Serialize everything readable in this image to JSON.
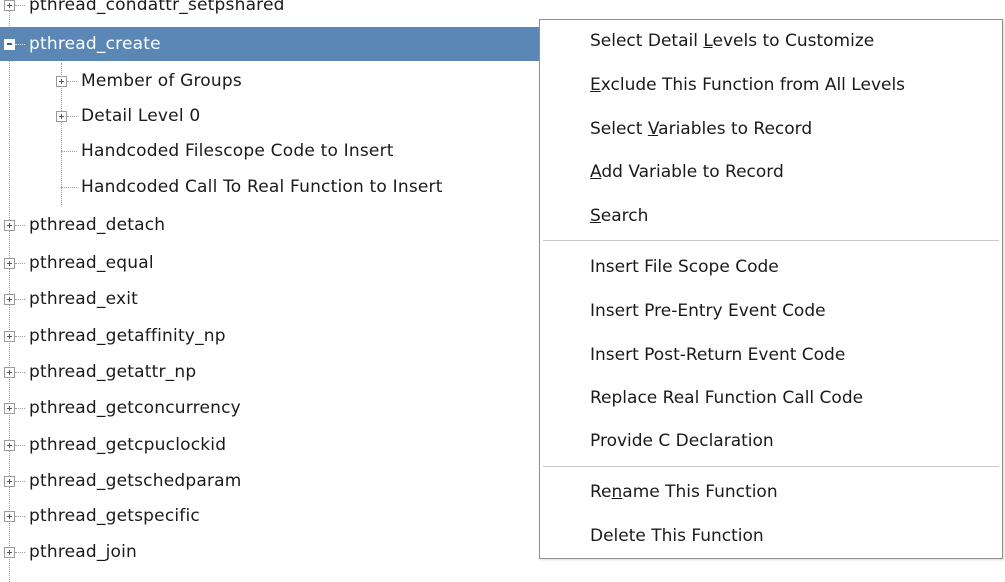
{
  "tree": {
    "items": [
      {
        "label": "pthread_condattr_setpshared",
        "expander": "plus"
      },
      {
        "label": "pthread_create",
        "expander": "minus",
        "selected": true
      },
      {
        "label": "Member of Groups",
        "expander": "plus",
        "child": true
      },
      {
        "label": "Detail Level 0",
        "expander": "plus",
        "child": true
      },
      {
        "label": "Handcoded Filescope Code to Insert",
        "expander": "none",
        "child": true
      },
      {
        "label": "Handcoded Call To Real Function to Insert",
        "expander": "none",
        "child": true
      },
      {
        "label": "pthread_detach",
        "expander": "plus"
      },
      {
        "label": "pthread_equal",
        "expander": "plus"
      },
      {
        "label": "pthread_exit",
        "expander": "plus"
      },
      {
        "label": "pthread_getaffinity_np",
        "expander": "plus"
      },
      {
        "label": "pthread_getattr_np",
        "expander": "plus"
      },
      {
        "label": "pthread_getconcurrency",
        "expander": "plus"
      },
      {
        "label": "pthread_getcpuclockid",
        "expander": "plus"
      },
      {
        "label": "pthread_getschedparam",
        "expander": "plus"
      },
      {
        "label": "pthread_getspecific",
        "expander": "plus"
      },
      {
        "label": "pthread_join",
        "expander": "plus"
      }
    ]
  },
  "context_menu": {
    "items": [
      {
        "pre": "Select Detail ",
        "mn": "L",
        "post": "evels to Customize"
      },
      {
        "pre": "",
        "mn": "E",
        "post": "xclude This Function from All Levels"
      },
      {
        "pre": "Select ",
        "mn": "V",
        "post": "ariables to Record"
      },
      {
        "pre": "",
        "mn": "A",
        "post": "dd Variable to Record"
      },
      {
        "pre": "",
        "mn": "S",
        "post": "earch"
      },
      {
        "separator": true
      },
      {
        "pre": "Insert File Scope Code",
        "mn": "",
        "post": ""
      },
      {
        "pre": "Insert Pre-Entry Event Code",
        "mn": "",
        "post": ""
      },
      {
        "pre": "Insert Post-Return Event Code",
        "mn": "",
        "post": ""
      },
      {
        "pre": "Replace Real Function Call Code",
        "mn": "",
        "post": ""
      },
      {
        "pre": "Provide C Declaration",
        "mn": "",
        "post": ""
      },
      {
        "separator": true
      },
      {
        "pre": "Re",
        "mn": "n",
        "post": "ame This Function"
      },
      {
        "pre": "Delete This Function",
        "mn": "",
        "post": ""
      }
    ]
  }
}
